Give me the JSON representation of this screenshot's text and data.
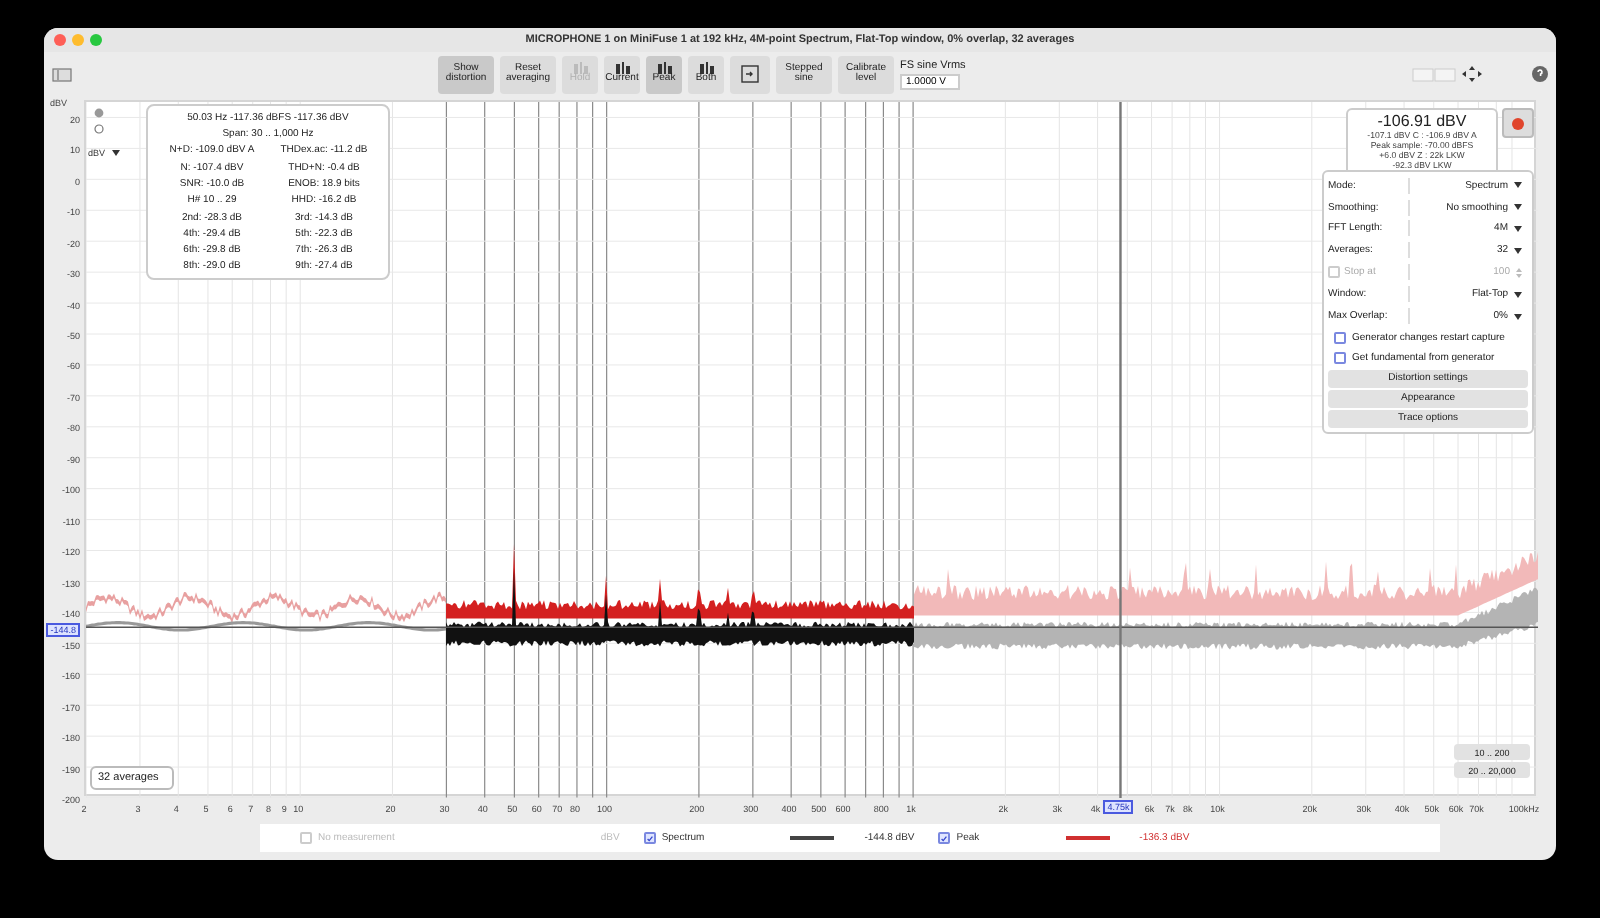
{
  "window": {
    "title": "MICROPHONE 1 on MiniFuse 1 at 192 kHz, 4M-point Spectrum, Flat-Top window, 0% overlap, 32 averages"
  },
  "toolbar": {
    "buttons": [
      {
        "label": "Show distortion",
        "kind": "text",
        "selected": true,
        "disabled": false
      },
      {
        "label": "Reset averaging",
        "kind": "text",
        "selected": false,
        "disabled": false
      },
      {
        "label": "Hold",
        "kind": "icon",
        "selected": false,
        "disabled": true
      },
      {
        "label": "Current",
        "kind": "icon",
        "selected": false,
        "disabled": false
      },
      {
        "label": "Peak",
        "kind": "icon",
        "selected": true,
        "disabled": false
      },
      {
        "label": "Both",
        "kind": "icon",
        "selected": false,
        "disabled": false
      },
      {
        "kind": "capture",
        "selected": false,
        "disabled": false
      },
      {
        "label": "Stepped sine",
        "kind": "text",
        "selected": false,
        "disabled": false
      },
      {
        "label": "Calibrate level",
        "kind": "text",
        "selected": false,
        "disabled": false
      }
    ],
    "generator": {
      "label": "FS sine Vrms",
      "value": "1.0000 V"
    }
  },
  "plot": {
    "y_unit": "dBV",
    "unit_select": "dBV",
    "y_ticks": [
      "20",
      "10",
      "0",
      "-10",
      "-20",
      "-30",
      "-40",
      "-50",
      "-60",
      "-70",
      "-80",
      "-90",
      "-100",
      "-110",
      "-120",
      "-130",
      "-140",
      "-150",
      "-160",
      "-170",
      "-180",
      "-190",
      "-200"
    ],
    "y_cursor": "-144.8",
    "x_ticks": [
      "2",
      "3",
      "4",
      "5",
      "6",
      "7",
      "8",
      "9",
      "10",
      "20",
      "30",
      "40",
      "50",
      "60",
      "70",
      "80",
      "100",
      "200",
      "300",
      "400",
      "500",
      "600",
      "800",
      "1k",
      "2k",
      "3k",
      "4k",
      "6k",
      "7k",
      "8k",
      "10k",
      "20k",
      "30k",
      "40k",
      "50k",
      "60k",
      "70k",
      "100kHz"
    ],
    "x_cursor": "4.75k",
    "averages_badge": "32 averages",
    "range_buttons": [
      "10 .. 200",
      "20 .. 20,000"
    ]
  },
  "measurements": {
    "header": "50.03 Hz  -117.36 dBFS  -117.36 dBV",
    "span": "Span: 30 .. 1,000 Hz",
    "rows": [
      [
        "N+D:",
        "-109.0 dBV A",
        "THDex.ac:",
        "-11.2 dB"
      ],
      [
        "N:",
        "-107.4 dBV",
        "THD+N:",
        "-0.4 dB"
      ],
      [
        "SNR:",
        "-10.0 dB",
        "ENOB:",
        "18.9 bits"
      ],
      [
        "H# 10 .. 29",
        "",
        "HHD:",
        "-16.2 dB"
      ],
      [
        "2nd:",
        "-28.3 dB",
        "3rd:",
        "-14.3 dB"
      ],
      [
        "4th:",
        "-29.4 dB",
        "5th:",
        "-22.3 dB"
      ],
      [
        "6th:",
        "-29.8 dB",
        "7th:",
        "-26.3 dB"
      ],
      [
        "8th:",
        "-29.0 dB",
        "9th:",
        "-27.4 dB"
      ]
    ]
  },
  "readout": {
    "value": "-106.91 dBV",
    "details": [
      "-107.1 dBV C : -106.9 dBV A",
      "Peak sample: -70.00 dBFS",
      "+6.0 dBV Z : 22k LKW",
      "-92.3 dBV LKW"
    ]
  },
  "settings": {
    "fields": [
      {
        "label": "Mode:",
        "value": "Spectrum",
        "kind": "select",
        "disabled": false
      },
      {
        "label": "Smoothing:",
        "value": "No smoothing",
        "kind": "select",
        "disabled": false
      },
      {
        "label": "FFT Length:",
        "value": "4M",
        "kind": "select",
        "disabled": false
      },
      {
        "label": "Averages:",
        "value": "32",
        "kind": "select",
        "disabled": false
      },
      {
        "label": "Stop at",
        "value": "100",
        "kind": "stepper",
        "disabled": true,
        "checked": false
      },
      {
        "label": "Window:",
        "value": "Flat-Top",
        "kind": "select",
        "disabled": false
      },
      {
        "label": "Max Overlap:",
        "value": "0%",
        "kind": "select",
        "disabled": false
      }
    ],
    "checkboxes": [
      {
        "label": "Generator changes restart capture",
        "checked": false
      },
      {
        "label": "Get fundamental from generator",
        "checked": false
      }
    ],
    "buttons": [
      "Distortion settings",
      "Appearance",
      "Trace options"
    ]
  },
  "legend": [
    {
      "label": "No measurement",
      "checked": false,
      "disabled": true,
      "unit": "dBV"
    },
    {
      "label": "Spectrum",
      "checked": true,
      "disabled": false,
      "color": "#444444",
      "reading": "-144.8 dBV"
    },
    {
      "label": "Peak",
      "checked": true,
      "disabled": false,
      "color": "#d03030",
      "reading": "-136.3 dBV"
    }
  ]
}
